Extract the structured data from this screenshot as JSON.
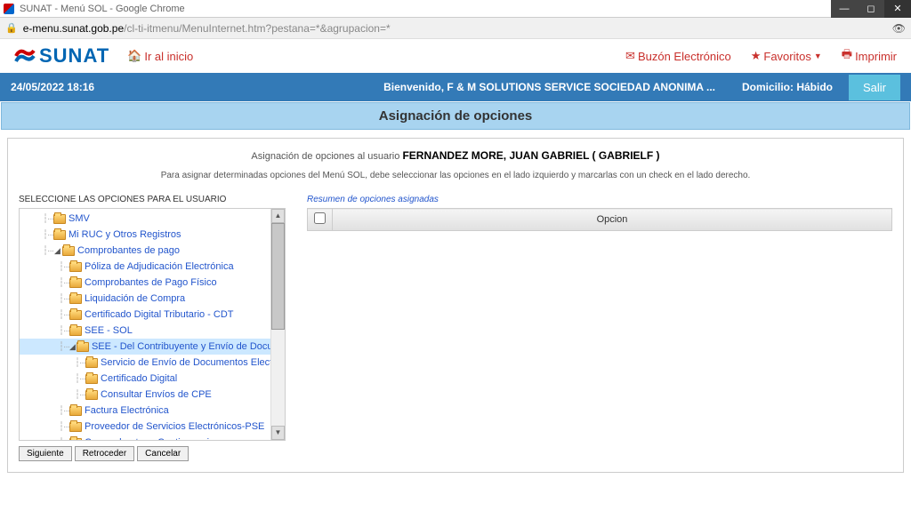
{
  "window": {
    "title": "SUNAT - Menú SOL - Google Chrome"
  },
  "url": {
    "host": "e-menu.sunat.gob.pe",
    "path": "/cl-ti-itmenu/MenuInternet.htm?pestana=*&agrupacion=*"
  },
  "header": {
    "logo_text": "SUNAT",
    "home": "Ir al inicio",
    "buzon": "Buzón Electrónico",
    "favoritos": "Favoritos",
    "imprimir": "Imprimir"
  },
  "welcome": {
    "datetime": "24/05/2022 18:16",
    "text": "Bienvenido, F & M SOLUTIONS SERVICE SOCIEDAD ANONIMA ...",
    "domicilio": "Domicilio: Hábido",
    "salir": "Salir"
  },
  "section": {
    "title": "Asignación de opciones"
  },
  "assign": {
    "prefix": "Asignación de opciones al usuario",
    "user": "FERNANDEZ MORE, JUAN GABRIEL ( GABRIELF )",
    "hint": "Para asignar determinadas opciones del Menú SOL, debe seleccionar las opciones en el lado izquierdo y marcarlas con un check en el lado derecho.",
    "left_title": "SELECCIONE LAS OPCIONES PARA EL USUARIO",
    "right_title": "Resumen de opciones asignadas"
  },
  "tree": [
    {
      "level": 1,
      "label": "SMV",
      "blue": true
    },
    {
      "level": 1,
      "label": "Mi RUC y Otros Registros",
      "blue": true
    },
    {
      "level": 1,
      "label": "Comprobantes de pago",
      "blue": true,
      "open": true
    },
    {
      "level": 2,
      "label": "Póliza de Adjudicación Electrónica",
      "blue": true
    },
    {
      "level": 2,
      "label": "Comprobantes de Pago Físico",
      "blue": true
    },
    {
      "level": 2,
      "label": "Liquidación de Compra",
      "blue": true
    },
    {
      "level": 2,
      "label": "Certificado Digital Tributario - CDT",
      "blue": true
    },
    {
      "level": 2,
      "label": "SEE - SOL",
      "blue": true
    },
    {
      "level": 2,
      "label": "SEE - Del Contribuyente y Envío de Documentos",
      "blue": true,
      "open": true,
      "selected": true
    },
    {
      "level": 3,
      "label": "Servicio de Envío de Documentos Electrónicos",
      "blue": true
    },
    {
      "level": 3,
      "label": "Certificado Digital",
      "blue": true
    },
    {
      "level": 3,
      "label": "Consultar Envíos de CPE",
      "blue": true
    },
    {
      "level": 2,
      "label": "Factura Electrónica",
      "blue": true
    },
    {
      "level": 2,
      "label": "Proveedor de Servicios Electrónicos-PSE",
      "blue": true
    },
    {
      "level": 2,
      "label": "Comprobantes - Contingencia",
      "blue": true
    }
  ],
  "table": {
    "header_opcion": "Opcion"
  },
  "buttons": {
    "siguiente": "Siguiente",
    "retroceder": "Retroceder",
    "cancelar": "Cancelar"
  }
}
